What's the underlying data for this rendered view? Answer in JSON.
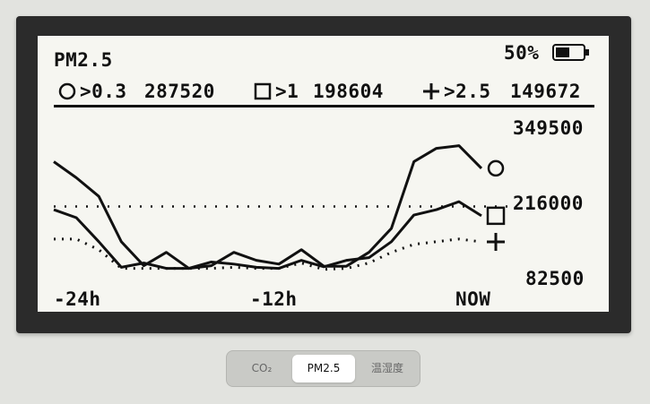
{
  "screen": {
    "title": "PM2.5",
    "battery_text": "50%",
    "battery_level": 0.5,
    "legend": [
      {
        "symbol": "circle-icon",
        "label": ">0.3",
        "value": "287520"
      },
      {
        "symbol": "square-icon",
        "label": ">1",
        "value": "198604"
      },
      {
        "symbol": "plus-icon",
        "label": ">2.5",
        "value": "149672"
      }
    ],
    "y_labels": [
      "349500",
      "216000",
      "82500"
    ],
    "x_labels": [
      "-24h",
      "-12h",
      "NOW"
    ]
  },
  "tabs": [
    {
      "label": "CO₂",
      "active": false
    },
    {
      "label": "PM2.5",
      "active": true
    },
    {
      "label": "温湿度",
      "active": false
    }
  ],
  "colors": {
    "ink": "#111111",
    "screen_bg": "#f6f6f1",
    "bezel": "#2b2b2b",
    "page_bg": "#e2e3df"
  },
  "chart_data": {
    "type": "line",
    "x_labels": [
      "-24h",
      "-12h",
      "NOW"
    ],
    "y_ticks": [
      349500,
      216000,
      82500
    ],
    "ylim": [
      82500,
      349500
    ],
    "dotted_reference": 216000,
    "series": [
      {
        "name": ">0.3",
        "symbol": "circle",
        "last_value": 287520,
        "values": [
          300000,
          270000,
          235000,
          150000,
          105000,
          130000,
          100000,
          105000,
          130000,
          115000,
          108000,
          135000,
          104000,
          104000,
          130000,
          175000,
          300000,
          325000,
          330000,
          287520
        ]
      },
      {
        "name": ">1",
        "symbol": "square",
        "last_value": 198604,
        "values": [
          210000,
          195000,
          150000,
          102000,
          110000,
          100000,
          100000,
          112000,
          108000,
          102000,
          100000,
          115000,
          103000,
          115000,
          120000,
          150000,
          200000,
          210000,
          225000,
          198604
        ]
      },
      {
        "name": ">2.5",
        "symbol": "plus",
        "last_value": 149672,
        "values": [
          155000,
          155000,
          135000,
          100000,
          100000,
          100000,
          100000,
          100000,
          102000,
          100000,
          100000,
          110000,
          98000,
          100000,
          110000,
          130000,
          145000,
          150000,
          155000,
          149672
        ]
      }
    ]
  }
}
